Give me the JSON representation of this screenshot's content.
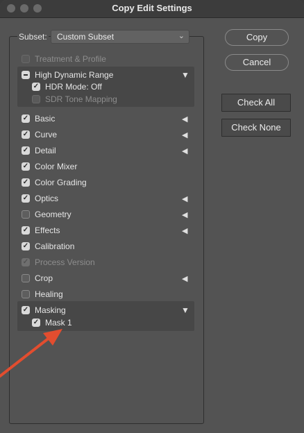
{
  "window": {
    "title": "Copy Edit Settings"
  },
  "subset": {
    "label": "Subset:",
    "value": "Custom Subset"
  },
  "buttons": {
    "copy": "Copy",
    "cancel": "Cancel",
    "check_all": "Check All",
    "check_none": "Check None"
  },
  "items": {
    "treatment_profile": {
      "label": "Treatment & Profile",
      "checked": false,
      "disabled": true
    },
    "hdr": {
      "label": "High Dynamic Range",
      "state": "mixed",
      "expanded": true
    },
    "hdr_mode": {
      "label": "HDR Mode: Off",
      "checked": true
    },
    "sdr_tone": {
      "label": "SDR Tone Mapping",
      "checked": false,
      "disabled": true
    },
    "basic": {
      "label": "Basic",
      "checked": true
    },
    "curve": {
      "label": "Curve",
      "checked": true
    },
    "detail": {
      "label": "Detail",
      "checked": true
    },
    "color_mixer": {
      "label": "Color Mixer",
      "checked": true
    },
    "color_grading": {
      "label": "Color Grading",
      "checked": true
    },
    "optics": {
      "label": "Optics",
      "checked": true
    },
    "geometry": {
      "label": "Geometry",
      "checked": false
    },
    "effects": {
      "label": "Effects",
      "checked": true
    },
    "calibration": {
      "label": "Calibration",
      "checked": true
    },
    "process_version": {
      "label": "Process Version",
      "checked": true,
      "disabled": true
    },
    "crop": {
      "label": "Crop",
      "checked": false
    },
    "healing": {
      "label": "Healing",
      "checked": false
    },
    "masking": {
      "label": "Masking",
      "checked": true,
      "expanded": true
    },
    "mask1": {
      "label": "Mask 1",
      "checked": true
    }
  },
  "icons": {
    "checkmark": "✓",
    "collapsed": "◀",
    "expanded": "▼",
    "dropdown": "⌄"
  },
  "colors": {
    "arrow": "#e24d2f"
  }
}
